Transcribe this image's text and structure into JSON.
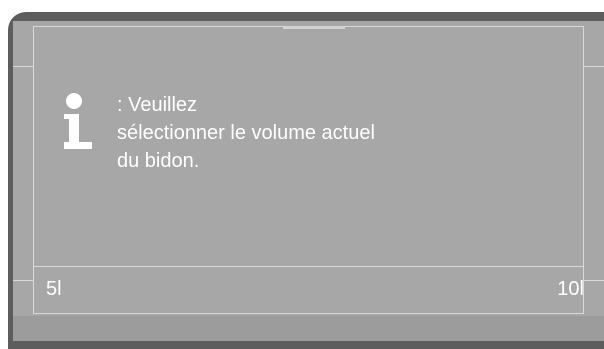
{
  "screen": {
    "message_lines": [
      ": Veuillez",
      "sélectionner le volume actuel",
      "du bidon."
    ],
    "icon": "info-icon",
    "slider": {
      "min_label": "5l",
      "max_label": "10l"
    }
  },
  "colors": {
    "background": "#ffffff",
    "frame": "#5d5d5d",
    "screen": "#a7a7a7",
    "footer": "#9c9c9c",
    "text": "#ffffff",
    "guides": "#d9d9d9"
  }
}
